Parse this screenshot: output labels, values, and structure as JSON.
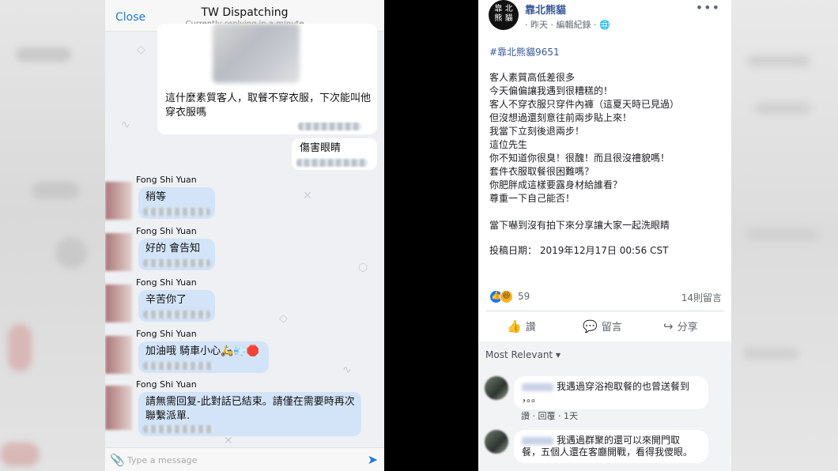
{
  "chat": {
    "close_label": "Close",
    "title": "TW Dispatching",
    "subtitle": "Currently replying in a minute",
    "first_message": "這什麼素質客人，取餐不穿衣服，下次能叫他穿衣服嗎",
    "reply_message": "傷害眼睛",
    "messages": [
      {
        "sender": "Fong Shi Yuan",
        "text": "稍等"
      },
      {
        "sender": "Fong Shi Yuan",
        "text": "好的 會告知"
      },
      {
        "sender": "Fong Shi Yuan",
        "text": "辛苦你了"
      },
      {
        "sender": "Fong Shi Yuan",
        "text": "加油哦 騎車小心🛵💨🛑"
      },
      {
        "sender": "Fong Shi Yuan",
        "text": "請無需回复-此對話已結束。請僅在需要時再次聯繫派單."
      }
    ],
    "input_placeholder": "Type a message"
  },
  "post": {
    "avatar_text": "靠北熊貓",
    "page_name": "靠北熊貓",
    "meta": "· 昨天 · 編輯紀錄 · ",
    "hashtag": "#靠北熊貓9651",
    "body_lines": [
      "客人素質高低差很多",
      "今天偏偏讓我遇到很糟糕的！",
      "客人不穿衣服只穿件內褲（這夏天時已見過）",
      "但沒想過還刻意往前兩步貼上來！",
      "我當下立刻後退兩步！",
      "這位先生",
      "你不知道你很臭！很醜！而且很沒禮貌嗎！",
      "套件衣服取餐很困難嗎？",
      "你肥胖成這樣要露身材給誰看？",
      "尊重一下自己能否！",
      "",
      "當下嚇到沒有拍下來分享讓大家一起洗眼睛"
    ],
    "date_line": "投稿日期： 2019年12月17日 00:56 CST",
    "reaction_count": "59",
    "comment_count": "14則留言",
    "actions": {
      "like": "讚",
      "comment": "留言",
      "share": "分享"
    },
    "sort_label": "Most Relevant ▾",
    "comments": [
      {
        "text": "我遇過穿浴袍取餐的也曾送餐到",
        "text2": "，。。",
        "like": "讚",
        "reply": "回覆",
        "time": "1天"
      },
      {
        "text": "我遇過群聚的還可以來開門取",
        "text2": "餐，五個人還在客廳開戰，看得我傻眼。"
      }
    ]
  },
  "colors": {
    "fb_link": "#385898",
    "chat_accent": "#1d7bd6",
    "bubble_blue": "#d3e4f8"
  }
}
